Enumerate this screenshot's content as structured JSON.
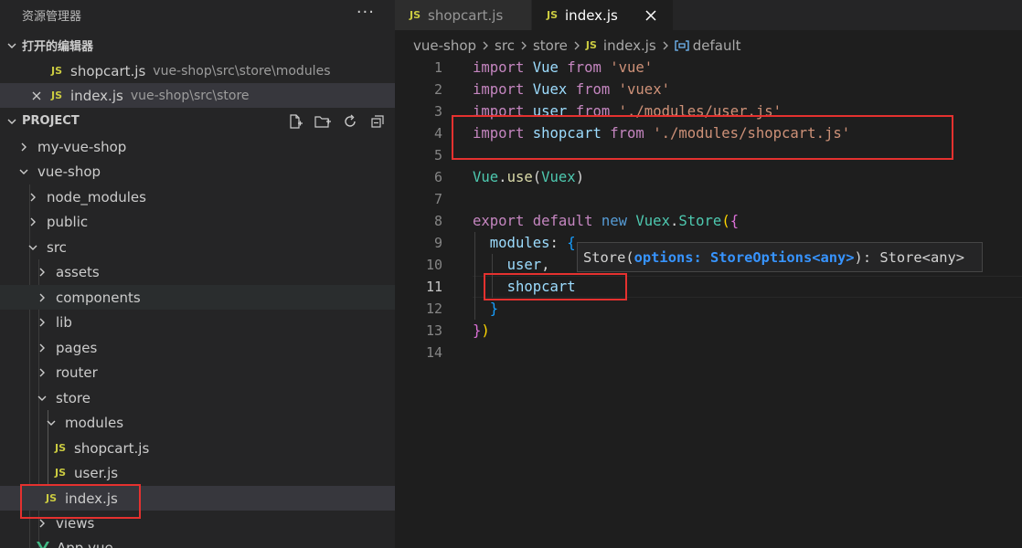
{
  "explorer": {
    "title": "资源管理器",
    "more_label": "···",
    "open_editors_label": "打开的编辑器",
    "open_editors": [
      {
        "badge": "JS",
        "name": "shopcart.js",
        "path": "vue-shop\\src\\store\\modules"
      },
      {
        "badge": "JS",
        "name": "index.js",
        "path": "vue-shop\\src\\store"
      }
    ],
    "project_label": "PROJECT",
    "tree": {
      "my_vue_shop": "my-vue-shop",
      "vue_shop": "vue-shop",
      "node_modules": "node_modules",
      "public": "public",
      "src": "src",
      "assets": "assets",
      "components": "components",
      "lib": "lib",
      "pages": "pages",
      "router": "router",
      "store": "store",
      "modules": "modules",
      "shopcart_js": "shopcart.js",
      "user_js": "user.js",
      "index_js": "index.js",
      "views": "views",
      "app_vue": "App.vue"
    },
    "js_badge": "JS"
  },
  "tabs": [
    {
      "badge": "JS",
      "label": "shopcart.js",
      "active": false
    },
    {
      "badge": "JS",
      "label": "index.js",
      "active": true
    }
  ],
  "breadcrumb": {
    "items": [
      "vue-shop",
      "src",
      "store"
    ],
    "file_badge": "JS",
    "file": "index.js",
    "symbol": "default"
  },
  "code": {
    "line_numbers": [
      "1",
      "2",
      "3",
      "4",
      "5",
      "6",
      "7",
      "8",
      "9",
      "10",
      "11",
      "12",
      "13",
      "14"
    ],
    "current_line": "11",
    "lines": {
      "l1": {
        "kw": "import",
        "id": "Vue",
        "from": "from",
        "str": "'vue'"
      },
      "l2": {
        "kw": "import",
        "id": "Vuex",
        "from": "from",
        "str": "'vuex'"
      },
      "l3": {
        "kw": "import",
        "id": "user",
        "from": "from",
        "str": "'./modules/user.js'"
      },
      "l4": {
        "kw": "import",
        "id": "shopcart",
        "from": "from",
        "str": "'./modules/shopcart.js'"
      },
      "l6": {
        "obj": "Vue",
        "dot": ".",
        "fn": "use",
        "open": "(",
        "arg": "Vuex",
        "close": ")"
      },
      "l8": {
        "kw1": "export",
        "kw2": "default",
        "kw3": "new",
        "cls": "Vuex",
        "dot": ".",
        "ctor": "Store",
        "open": "(",
        "brace": "{"
      },
      "l9": {
        "prop": "modules",
        "colon": ":",
        "brace": "{"
      },
      "l10": {
        "id": "user",
        "comma": ","
      },
      "l11": {
        "id": "shopcart"
      },
      "l12": {
        "brace": "}"
      },
      "l13": {
        "brace": "}",
        "close": ")"
      }
    }
  },
  "hover": {
    "fn": "Store",
    "open": "(",
    "param": "options: StoreOptions<any>",
    "close": "): Store<any>"
  },
  "colors": {
    "highlight_box": "#e5312f",
    "js_badge": "#cbcb41",
    "keyword": "#c586c0",
    "identifier": "#9cdcfe",
    "string": "#ce9178"
  }
}
